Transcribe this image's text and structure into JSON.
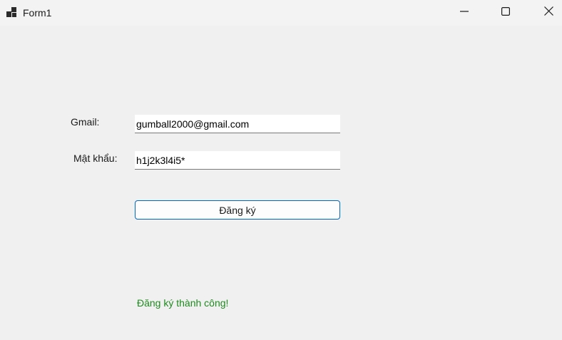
{
  "window": {
    "title": "Form1",
    "app_icon": "winforms-app-icon",
    "controls": [
      "minimize-icon",
      "maximize-icon",
      "close-icon"
    ]
  },
  "form": {
    "gmail_label": "Gmail:",
    "gmail_value": "gumball2000@gmail.com",
    "password_label": "Mật khẩu:",
    "password_value": "h1j2k3l4i5*",
    "submit_label": "Đăng ký",
    "status_message": "Đăng ký thành công!"
  },
  "colors": {
    "background": "#f0f0f0",
    "button_border": "#0067c0",
    "status_text": "#1f8a1f"
  }
}
